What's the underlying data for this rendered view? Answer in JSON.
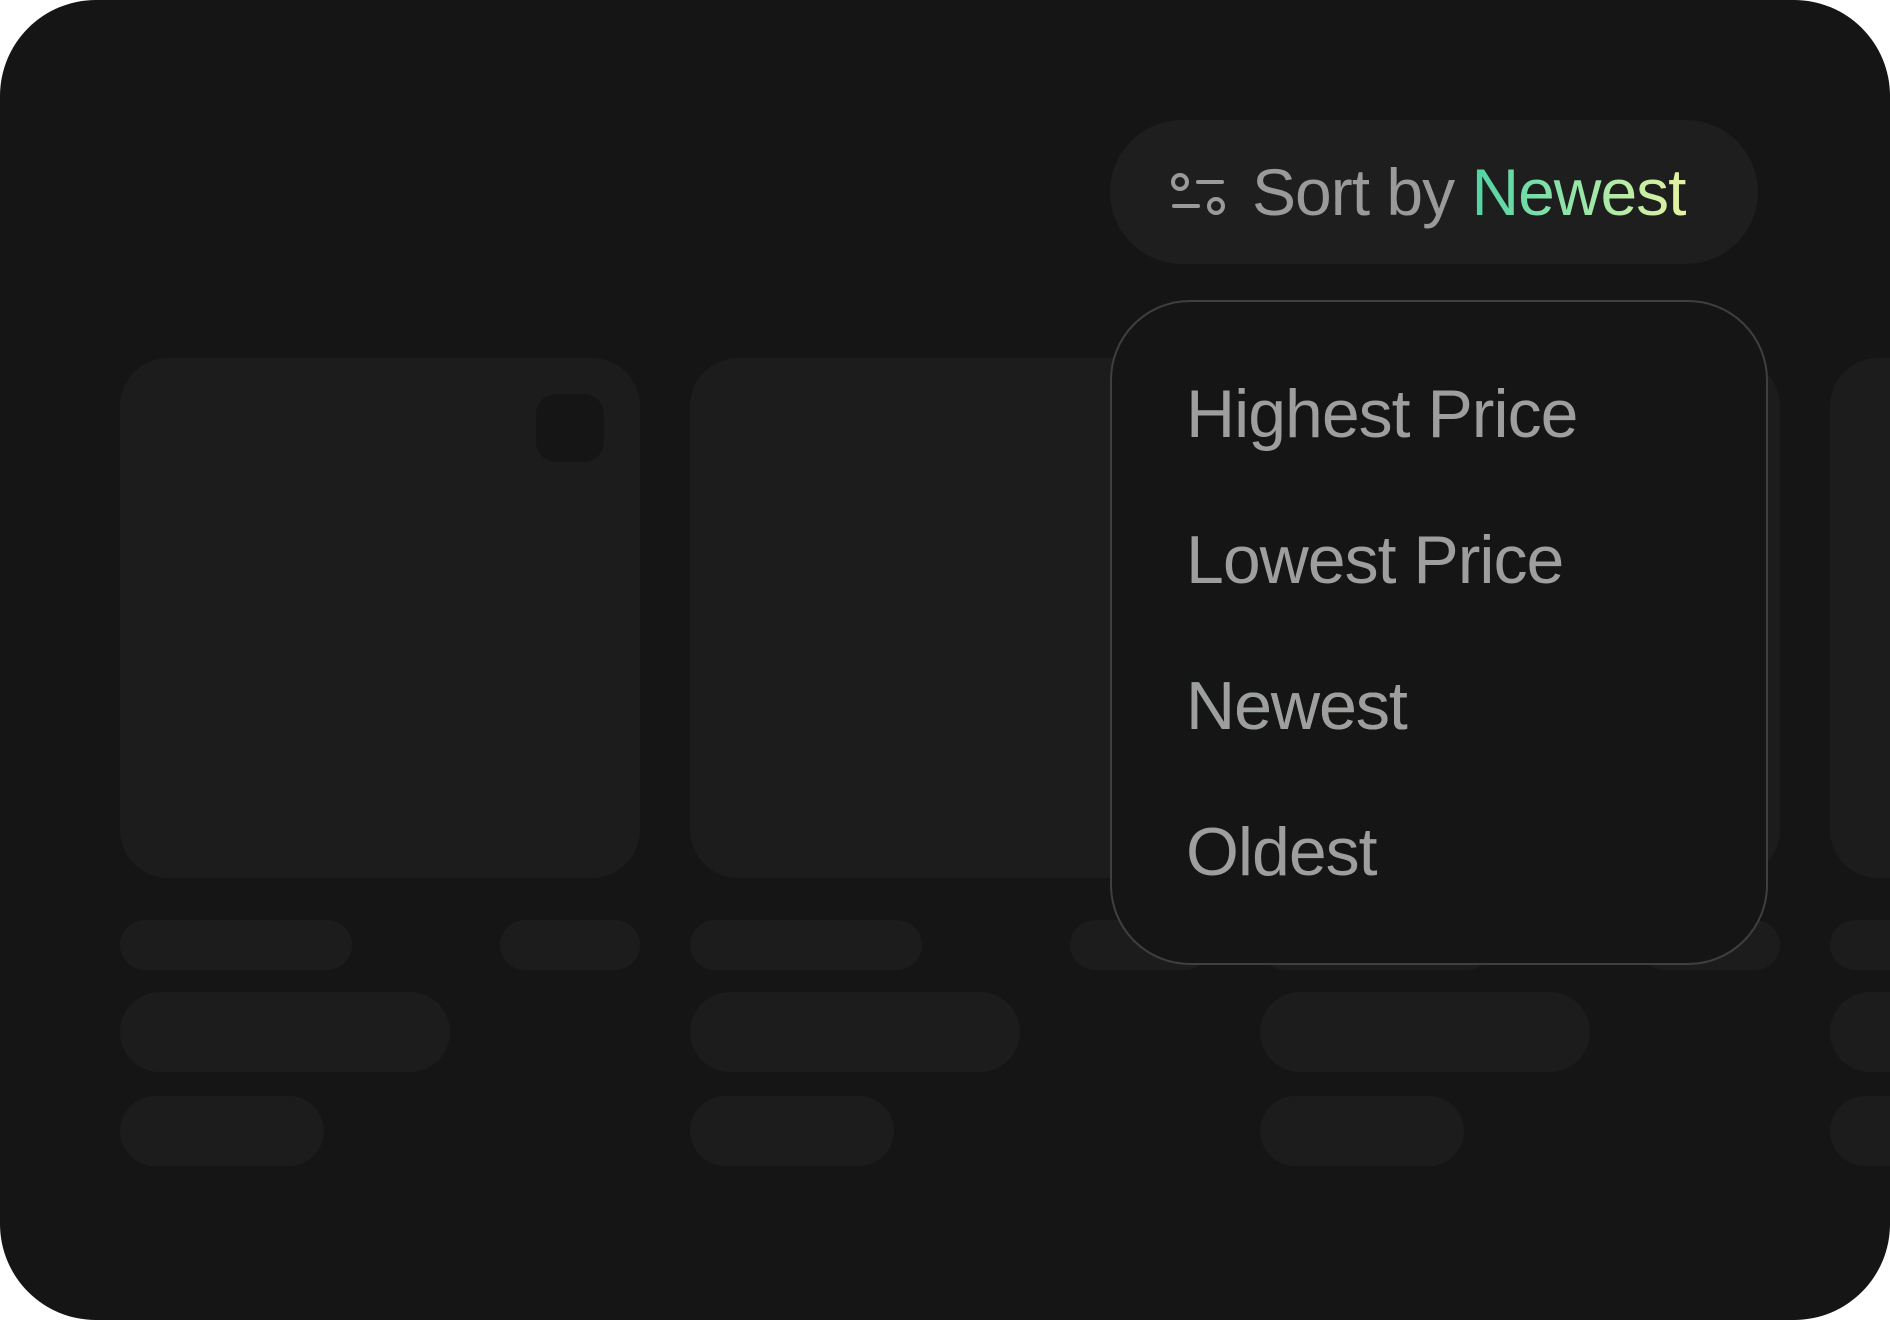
{
  "sort": {
    "prefix": "Sort by",
    "selected": "Newest",
    "icon": "sliders-icon"
  },
  "dropdown": {
    "options": [
      {
        "label": "Highest Price"
      },
      {
        "label": "Lowest Price"
      },
      {
        "label": "Newest"
      },
      {
        "label": "Oldest"
      }
    ],
    "selected_index": 2
  },
  "colors": {
    "background": "#151515",
    "skeleton": "#1c1c1c",
    "button": "#1e1e1e",
    "text_muted": "#9e9e9e",
    "accent_gradient_start": "#4fd2a3",
    "accent_gradient_end": "#e6f3a2",
    "dropdown_border": "#3f3f3f"
  }
}
